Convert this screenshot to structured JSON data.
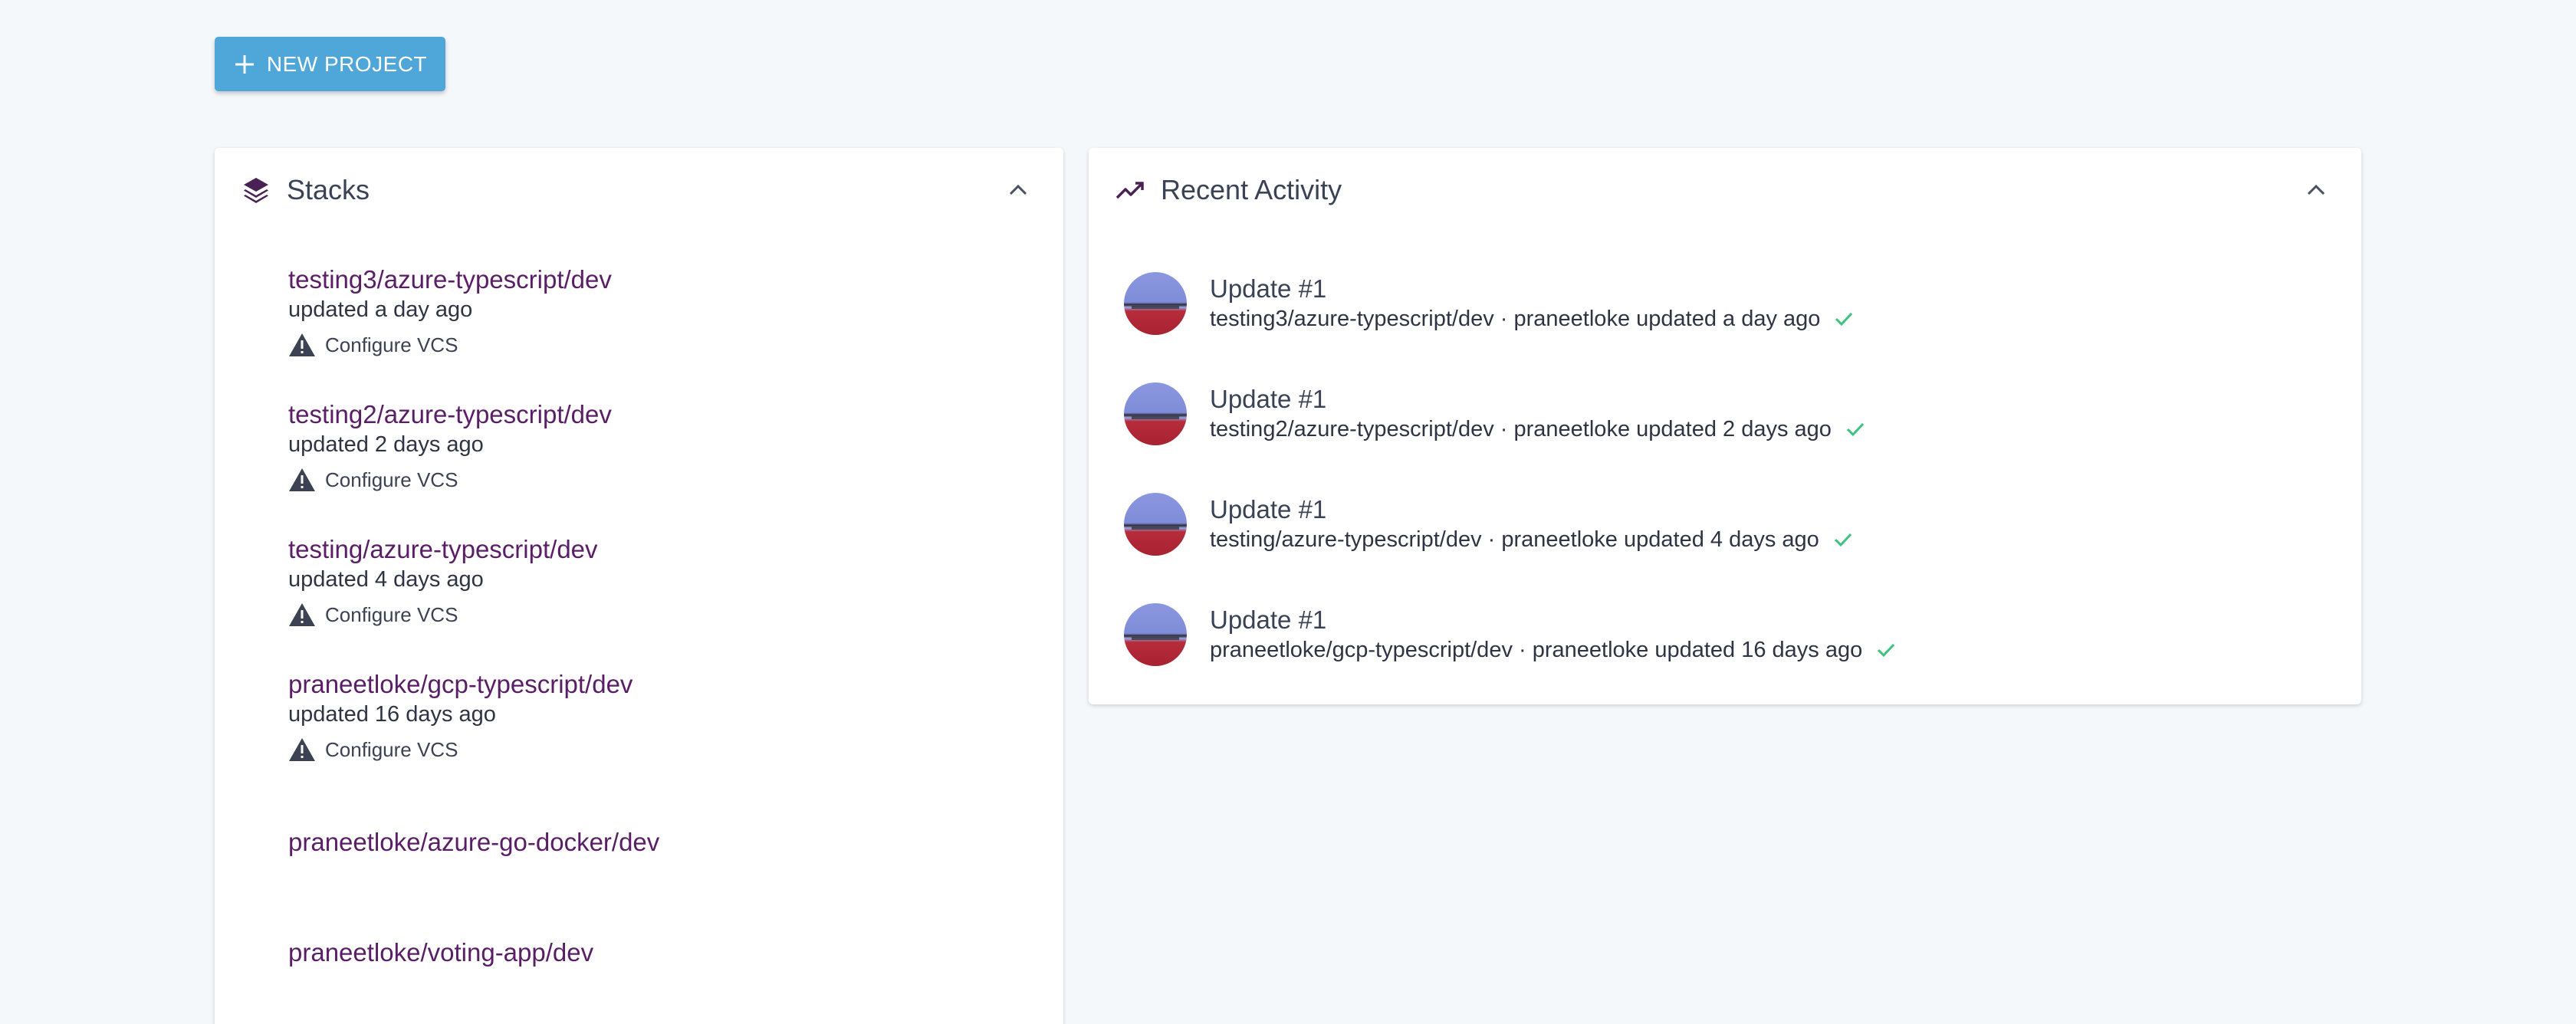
{
  "toolbar": {
    "new_project_label": "NEW PROJECT"
  },
  "stacks": {
    "title": "Stacks",
    "items": [
      {
        "name": "testing3/azure-typescript/dev",
        "updated": "updated a day ago",
        "vcs_label": "Configure VCS"
      },
      {
        "name": "testing2/azure-typescript/dev",
        "updated": "updated 2 days ago",
        "vcs_label": "Configure VCS"
      },
      {
        "name": "testing/azure-typescript/dev",
        "updated": "updated 4 days ago",
        "vcs_label": "Configure VCS"
      },
      {
        "name": "praneetloke/gcp-typescript/dev",
        "updated": "updated 16 days ago",
        "vcs_label": "Configure VCS"
      },
      {
        "name": "praneetloke/azure-go-docker/dev"
      },
      {
        "name": "praneetloke/voting-app/dev"
      }
    ]
  },
  "activity": {
    "title": "Recent Activity",
    "items": [
      {
        "title": "Update #1",
        "detail": "testing3/azure-typescript/dev · praneetloke updated a day ago"
      },
      {
        "title": "Update #1",
        "detail": "testing2/azure-typescript/dev · praneetloke updated 2 days ago"
      },
      {
        "title": "Update #1",
        "detail": "testing/azure-typescript/dev · praneetloke updated 4 days ago"
      },
      {
        "title": "Update #1",
        "detail": "praneetloke/gcp-typescript/dev · praneetloke updated 16 days ago"
      }
    ]
  },
  "colors": {
    "accent": "#4fa6d9",
    "stack_link": "#5a1e66",
    "success": "#3cc47c",
    "background": "#f5f8fb"
  },
  "icons": {
    "stacks": "layers-icon",
    "activity": "trending-up-icon",
    "collapse": "chevron-up-icon",
    "warning": "warning-icon",
    "success": "check-icon",
    "add": "plus-icon"
  }
}
